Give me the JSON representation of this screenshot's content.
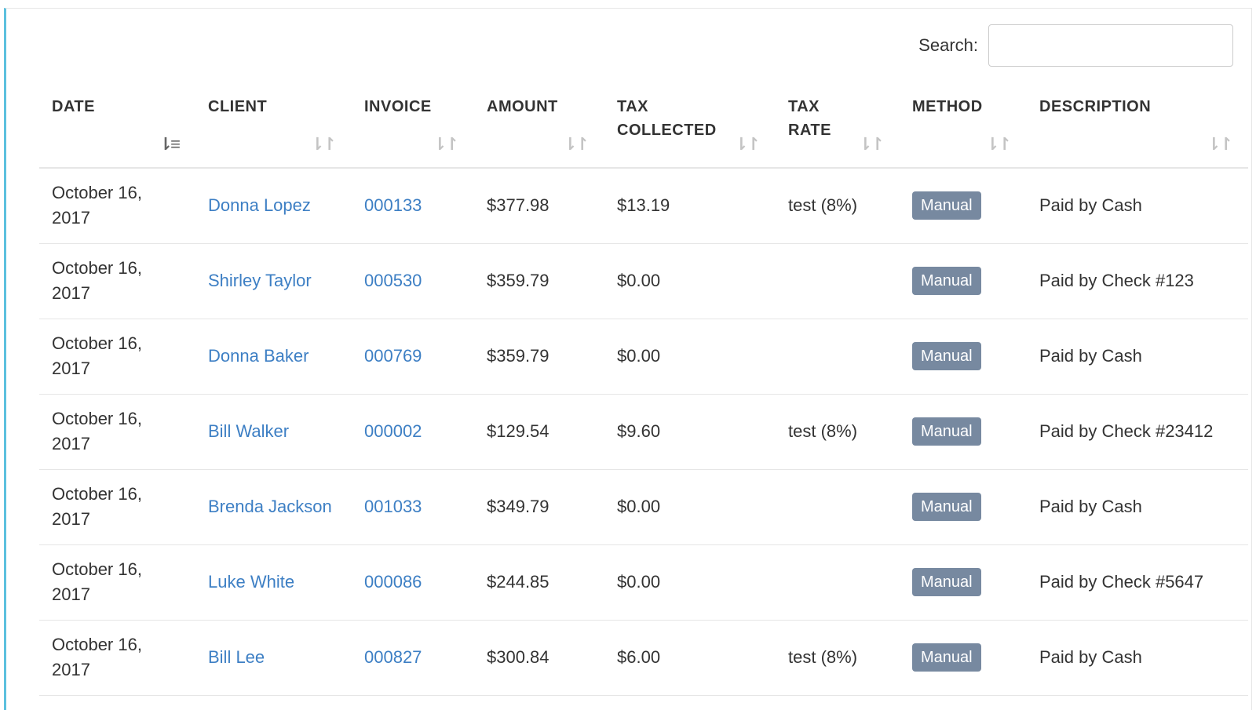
{
  "search": {
    "label": "Search:",
    "value": "",
    "placeholder": ""
  },
  "columns": [
    {
      "label": "DATE"
    },
    {
      "label": "CLIENT"
    },
    {
      "label": "INVOICE"
    },
    {
      "label": "AMOUNT"
    },
    {
      "label": "TAX COLLECTED"
    },
    {
      "label": "TAX RATE"
    },
    {
      "label": "METHOD"
    },
    {
      "label": "DESCRIPTION"
    }
  ],
  "rows": [
    {
      "date": "October 16, 2017",
      "client": "Donna Lopez",
      "invoice": "000133",
      "amount": "$377.98",
      "tax_collected": "$13.19",
      "tax_rate": "test (8%)",
      "method": "Manual",
      "description": "Paid by Cash"
    },
    {
      "date": "October 16, 2017",
      "client": "Shirley Taylor",
      "invoice": "000530",
      "amount": "$359.79",
      "tax_collected": "$0.00",
      "tax_rate": "",
      "method": "Manual",
      "description": "Paid by Check #123"
    },
    {
      "date": "October 16, 2017",
      "client": "Donna Baker",
      "invoice": "000769",
      "amount": "$359.79",
      "tax_collected": "$0.00",
      "tax_rate": "",
      "method": "Manual",
      "description": "Paid by Cash"
    },
    {
      "date": "October 16, 2017",
      "client": "Bill Walker",
      "invoice": "000002",
      "amount": "$129.54",
      "tax_collected": "$9.60",
      "tax_rate": "test (8%)",
      "method": "Manual",
      "description": "Paid by Check #23412"
    },
    {
      "date": "October 16, 2017",
      "client": "Brenda Jackson",
      "invoice": "001033",
      "amount": "$349.79",
      "tax_collected": "$0.00",
      "tax_rate": "",
      "method": "Manual",
      "description": "Paid by Cash"
    },
    {
      "date": "October 16, 2017",
      "client": "Luke White",
      "invoice": "000086",
      "amount": "$244.85",
      "tax_collected": "$0.00",
      "tax_rate": "",
      "method": "Manual",
      "description": "Paid by Check #5647"
    },
    {
      "date": "October 16, 2017",
      "client": "Bill Lee",
      "invoice": "000827",
      "amount": "$300.84",
      "tax_collected": "$6.00",
      "tax_rate": "test (8%)",
      "method": "Manual",
      "description": "Paid by Cash"
    }
  ],
  "icons": {
    "sort": "sort-icon",
    "sort_active": "sort-ascending-icon"
  },
  "colors": {
    "link": "#3d7fc4",
    "badge": "#7789a0",
    "accent_border": "#5bc0de"
  }
}
